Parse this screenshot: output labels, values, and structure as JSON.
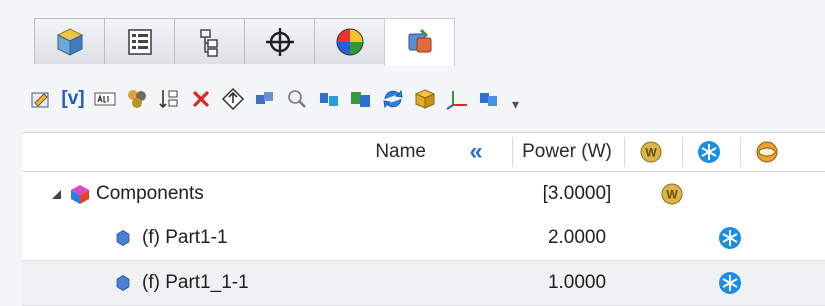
{
  "tabs": [
    {
      "icon": "cube-icon",
      "active": false
    },
    {
      "icon": "list-view-icon",
      "active": false
    },
    {
      "icon": "tree-view-icon",
      "active": false
    },
    {
      "icon": "crosshair-icon",
      "active": false
    },
    {
      "icon": "color-wheel-icon",
      "active": false
    },
    {
      "icon": "thermal-components-icon",
      "active": true
    }
  ],
  "toolbar": {
    "variable_label": "[v]",
    "overflow_icon": "chevron-down-icon"
  },
  "table": {
    "headers": {
      "name": "Name",
      "collapse": "«",
      "power": "Power (W)"
    },
    "rows": [
      {
        "name": "Components",
        "power": "[3.0000]"
      },
      {
        "name": "(f) Part1-1",
        "power": "2.0000"
      },
      {
        "name": "(f) Part1_1-1",
        "power": "1.0000"
      }
    ]
  },
  "colors": {
    "accent_blue": "#2b6fd6",
    "coolant_blue": "#1a8ee6",
    "power_gold": "#c9a53a"
  }
}
